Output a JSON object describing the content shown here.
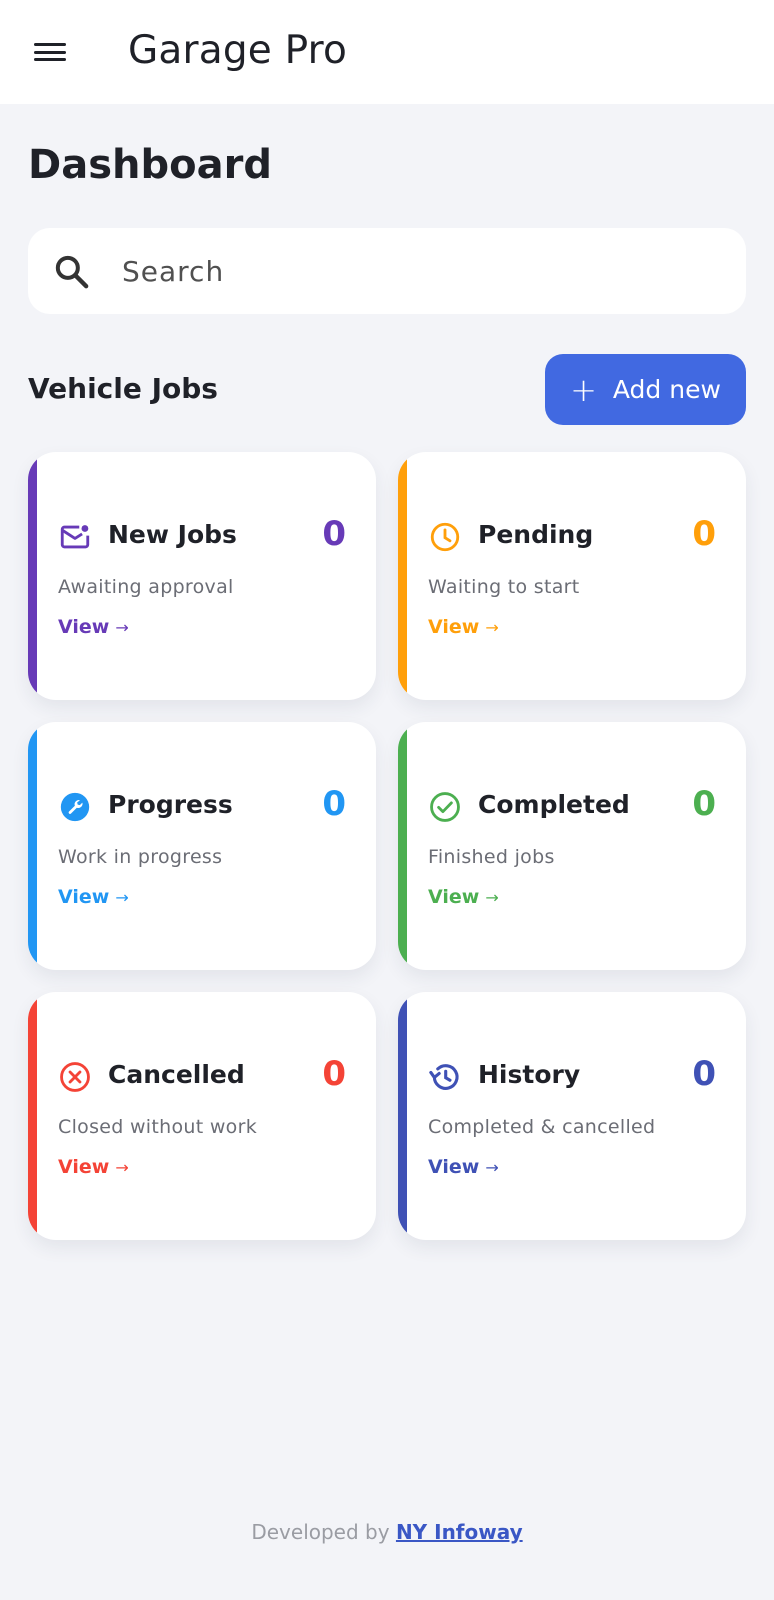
{
  "header": {
    "app_title": "Garage Pro"
  },
  "page": {
    "title": "Dashboard"
  },
  "search": {
    "placeholder": "Search"
  },
  "jobs_section": {
    "title": "Vehicle Jobs",
    "add_button_icon": "+",
    "add_button_label": "Add new"
  },
  "cards": [
    {
      "label": "New Jobs",
      "count": "0",
      "description": "Awaiting approval",
      "link": "View",
      "arrow": "→",
      "color": "#673ab7",
      "icon": "mail-icon"
    },
    {
      "label": "Pending",
      "count": "0",
      "description": "Waiting to start",
      "link": "View",
      "arrow": "→",
      "color": "#ff9f0a",
      "icon": "clock-icon"
    },
    {
      "label": "Progress",
      "count": "0",
      "description": "Work in progress",
      "link": "View",
      "arrow": "→",
      "color": "#2196f3",
      "icon": "wrench-icon"
    },
    {
      "label": "Completed",
      "count": "0",
      "description": "Finished jobs",
      "link": "View",
      "arrow": "→",
      "color": "#4caf50",
      "icon": "check-circle-icon"
    },
    {
      "label": "Cancelled",
      "count": "0",
      "description": "Closed without work",
      "link": "View",
      "arrow": "→",
      "color": "#f44336",
      "icon": "cancel-circle-icon"
    },
    {
      "label": "History",
      "count": "0",
      "description": "Completed & cancelled",
      "link": "View",
      "arrow": "→",
      "color": "#3f51b5",
      "icon": "history-icon"
    }
  ],
  "footer": {
    "prefix": "Developed by",
    "link_text": "NY Infoway"
  }
}
